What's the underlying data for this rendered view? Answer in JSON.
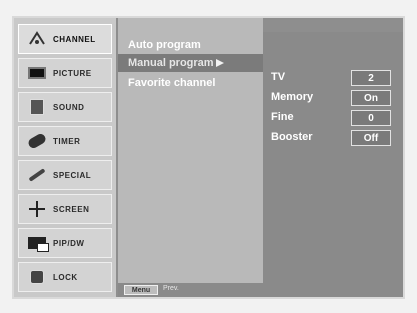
{
  "sidebar": {
    "items": [
      {
        "label": "CHANNEL",
        "icon": "channel-icon"
      },
      {
        "label": "PICTURE",
        "icon": "picture-icon"
      },
      {
        "label": "SOUND",
        "icon": "sound-icon"
      },
      {
        "label": "TIMER",
        "icon": "timer-icon"
      },
      {
        "label": "SPECIAL",
        "icon": "special-icon"
      },
      {
        "label": "SCREEN",
        "icon": "screen-icon"
      },
      {
        "label": "PIP/DW",
        "icon": "pip-icon"
      },
      {
        "label": "LOCK",
        "icon": "lock-icon"
      }
    ]
  },
  "submenu": {
    "items": [
      {
        "label": "Auto program"
      },
      {
        "label": "Manual program"
      },
      {
        "label": "Favorite channel"
      }
    ]
  },
  "panel": {
    "rows": [
      {
        "label": "TV",
        "value": "2"
      },
      {
        "label": "Memory",
        "value": "On"
      },
      {
        "label": "Fine",
        "value": "0"
      },
      {
        "label": "Booster",
        "value": "Off"
      }
    ]
  },
  "bottom": {
    "menu_label": "Menu",
    "prev_label": "Prev."
  }
}
